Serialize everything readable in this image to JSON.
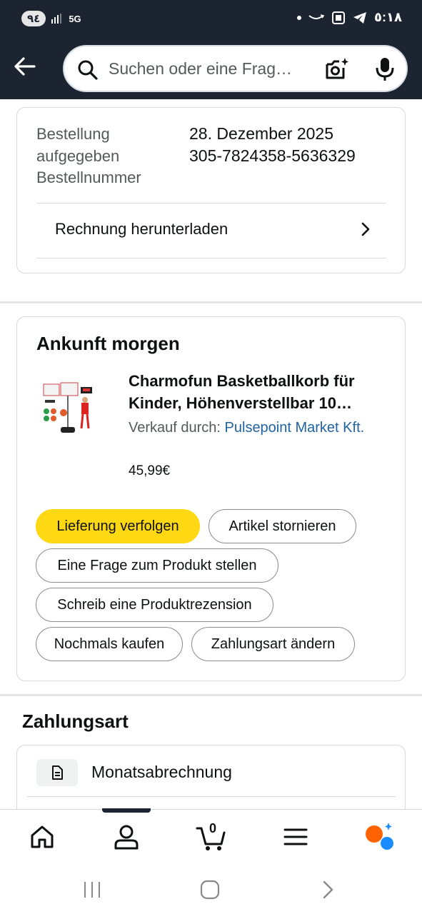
{
  "status_bar": {
    "battery": "٩٤",
    "network": "5G",
    "time": "٥:١٨"
  },
  "header": {
    "search_placeholder": "Suchen oder eine Frag…"
  },
  "order_info": {
    "placed_label": "Bestellung aufgegeben",
    "placed_value": "28. Dezember 2025",
    "number_label": "Bestellnummer",
    "number_value": "305-7824358-5636329",
    "invoice_link": "Rechnung herunterladen"
  },
  "shipment": {
    "heading": "Ankunft morgen",
    "product_title": "Charmofun Basketballkorb für Kinder, Höhenverstellbar 10…",
    "seller_prefix": "Verkauf durch:",
    "seller_name": "Pulsepoint Market Kft.",
    "price": "45,99€",
    "buttons": {
      "track": "Lieferung verfolgen",
      "cancel": "Artikel stornieren",
      "ask": "Eine Frage zum Produkt stellen",
      "review": "Schreib eine Produktrezension",
      "buy_again": "Nochmals kaufen",
      "change_payment": "Zahlungsart ändern"
    }
  },
  "payment": {
    "heading": "Zahlungsart",
    "method": "Monatsabrechnung"
  },
  "bottom_nav": {
    "items": [
      "home-icon",
      "account-icon",
      "cart-icon",
      "menu-icon",
      "rufus-icon"
    ],
    "cart_count": "0",
    "active": "account"
  },
  "colors": {
    "header_bg": "#1b2430",
    "primary_button": "#ffd814",
    "link": "#2162a1",
    "rufus_orange": "#ff6200",
    "rufus_blue": "#1a8cff"
  }
}
